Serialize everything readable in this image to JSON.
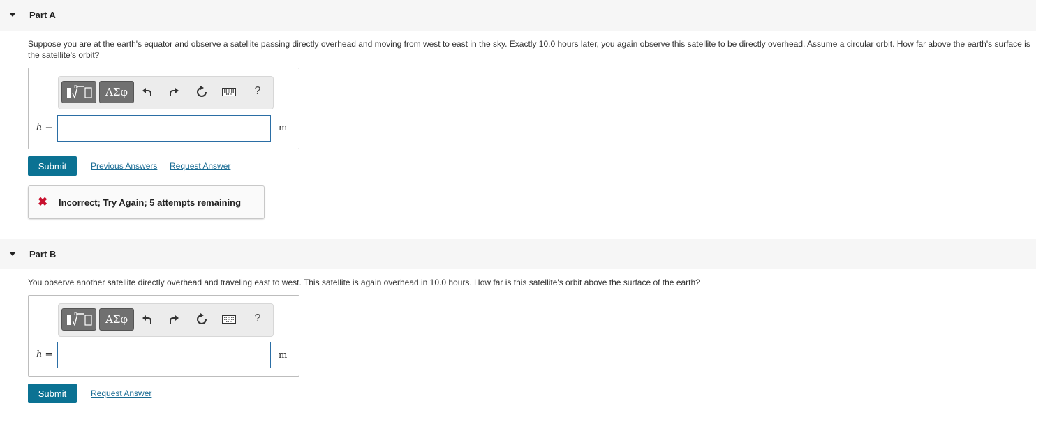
{
  "partA": {
    "title": "Part A",
    "question": "Suppose you are at the earth's equator and observe a satellite passing directly overhead and moving from west to east in the sky. Exactly 10.0 hours later, you again observe this satellite to be directly overhead. Assume a circular orbit. How far above the earth's surface is the satellite's orbit?",
    "variable": "h",
    "equals": "=",
    "unit": "m",
    "answer_value": "",
    "submit_label": "Submit",
    "previous_answers_label": "Previous Answers",
    "request_answer_label": "Request Answer",
    "feedback_text": "Incorrect; Try Again; 5 attempts remaining",
    "feedback_mark": "✖"
  },
  "partB": {
    "title": "Part B",
    "question": "You observe another satellite directly overhead and traveling east to west. This satellite is again overhead in 10.0 hours. How far is this satellite's orbit above the surface of the earth?",
    "variable": "h",
    "equals": "=",
    "unit": "m",
    "answer_value": "",
    "submit_label": "Submit",
    "request_answer_label": "Request Answer"
  },
  "toolbar": {
    "greek_label": "ΑΣφ",
    "help_label": "?"
  },
  "colors": {
    "submit": "#0b7293",
    "link": "#1a6c94",
    "error": "#c8102e",
    "input_border": "#2b6ea5"
  }
}
